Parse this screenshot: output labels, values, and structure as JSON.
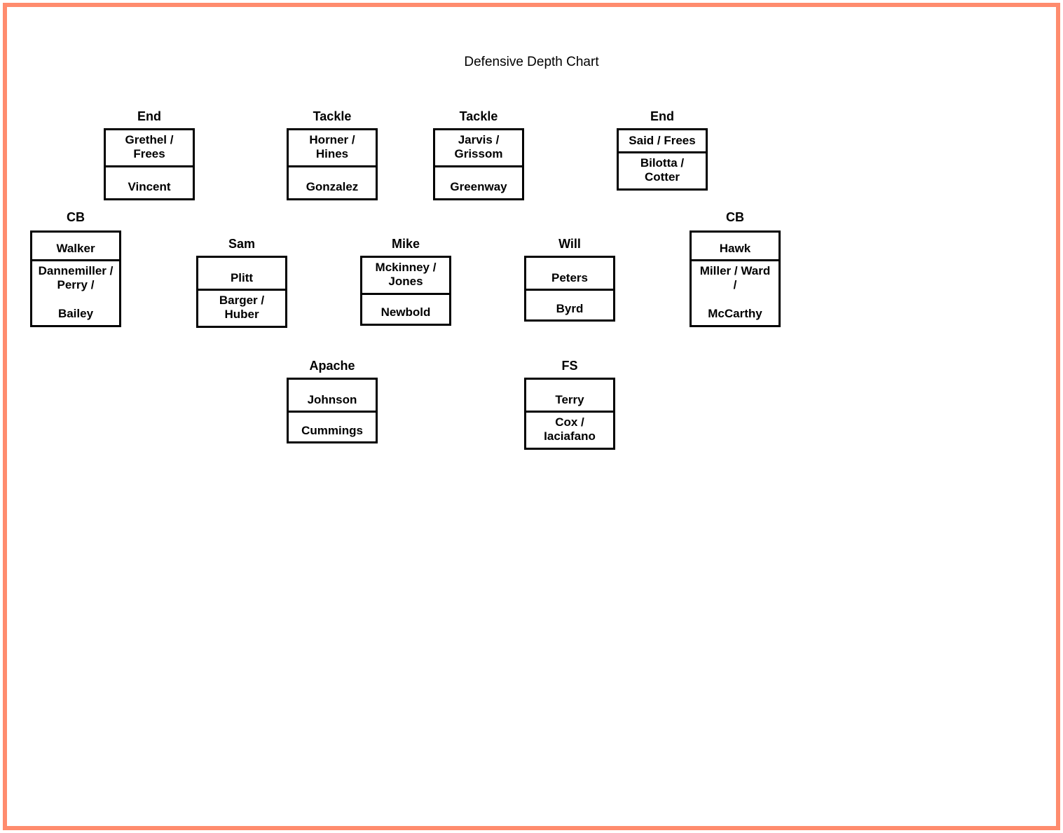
{
  "title": "Defensive Depth Chart",
  "line": {
    "end_left": {
      "label": "End",
      "starter": "Grethel /\nFrees",
      "backup": "Vincent"
    },
    "tackle_left": {
      "label": "Tackle",
      "starter": "Horner /\nHines",
      "backup": "Gonzalez"
    },
    "tackle_right": {
      "label": "Tackle",
      "starter": "Jarvis /\nGrissom",
      "backup": "Greenway"
    },
    "end_right": {
      "label": "End",
      "starter": "Said / Frees",
      "backup": "Bilotta /\nCotter"
    }
  },
  "second": {
    "cb_left": {
      "label": "CB",
      "starter": "Walker",
      "backup": "Dannemiller /\nPerry /\n\nBailey"
    },
    "sam": {
      "label": "Sam",
      "starter": "Plitt",
      "backup": "Barger /\nHuber"
    },
    "mike": {
      "label": "Mike",
      "starter": "Mckinney /\nJones",
      "backup": "Newbold"
    },
    "will": {
      "label": "Will",
      "starter": "Peters",
      "backup": "Byrd"
    },
    "cb_right": {
      "label": "CB",
      "starter": "Hawk",
      "backup": "Miller / Ward\n/\n\nMcCarthy"
    }
  },
  "deep": {
    "apache": {
      "label": "Apache",
      "starter": "Johnson",
      "backup": "Cummings"
    },
    "fs": {
      "label": "FS",
      "starter": "Terry",
      "backup": "Cox /\nIaciafano"
    }
  }
}
